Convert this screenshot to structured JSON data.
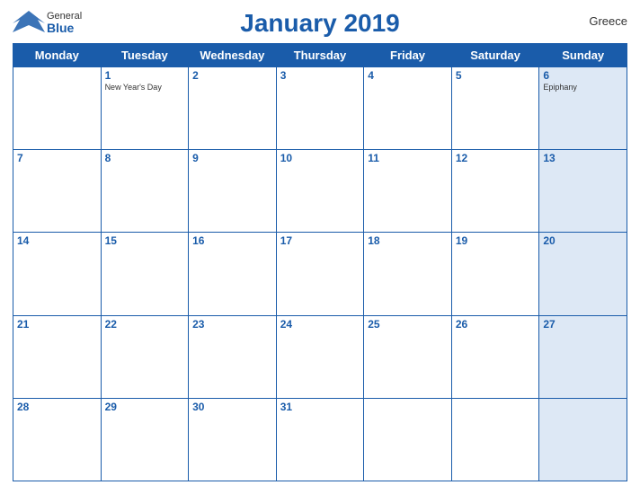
{
  "header": {
    "title": "January 2019",
    "country": "Greece",
    "logo": {
      "general": "General",
      "blue": "Blue"
    }
  },
  "days_of_week": [
    "Monday",
    "Tuesday",
    "Wednesday",
    "Thursday",
    "Friday",
    "Saturday",
    "Sunday"
  ],
  "weeks": [
    [
      {
        "day": "",
        "holiday": ""
      },
      {
        "day": "1",
        "holiday": "New Year's Day"
      },
      {
        "day": "2",
        "holiday": ""
      },
      {
        "day": "3",
        "holiday": ""
      },
      {
        "day": "4",
        "holiday": ""
      },
      {
        "day": "5",
        "holiday": ""
      },
      {
        "day": "6",
        "holiday": "Epiphany"
      }
    ],
    [
      {
        "day": "7",
        "holiday": ""
      },
      {
        "day": "8",
        "holiday": ""
      },
      {
        "day": "9",
        "holiday": ""
      },
      {
        "day": "10",
        "holiday": ""
      },
      {
        "day": "11",
        "holiday": ""
      },
      {
        "day": "12",
        "holiday": ""
      },
      {
        "day": "13",
        "holiday": ""
      }
    ],
    [
      {
        "day": "14",
        "holiday": ""
      },
      {
        "day": "15",
        "holiday": ""
      },
      {
        "day": "16",
        "holiday": ""
      },
      {
        "day": "17",
        "holiday": ""
      },
      {
        "day": "18",
        "holiday": ""
      },
      {
        "day": "19",
        "holiday": ""
      },
      {
        "day": "20",
        "holiday": ""
      }
    ],
    [
      {
        "day": "21",
        "holiday": ""
      },
      {
        "day": "22",
        "holiday": ""
      },
      {
        "day": "23",
        "holiday": ""
      },
      {
        "day": "24",
        "holiday": ""
      },
      {
        "day": "25",
        "holiday": ""
      },
      {
        "day": "26",
        "holiday": ""
      },
      {
        "day": "27",
        "holiday": ""
      }
    ],
    [
      {
        "day": "28",
        "holiday": ""
      },
      {
        "day": "29",
        "holiday": ""
      },
      {
        "day": "30",
        "holiday": ""
      },
      {
        "day": "31",
        "holiday": ""
      },
      {
        "day": "",
        "holiday": ""
      },
      {
        "day": "",
        "holiday": ""
      },
      {
        "day": "",
        "holiday": ""
      }
    ]
  ]
}
